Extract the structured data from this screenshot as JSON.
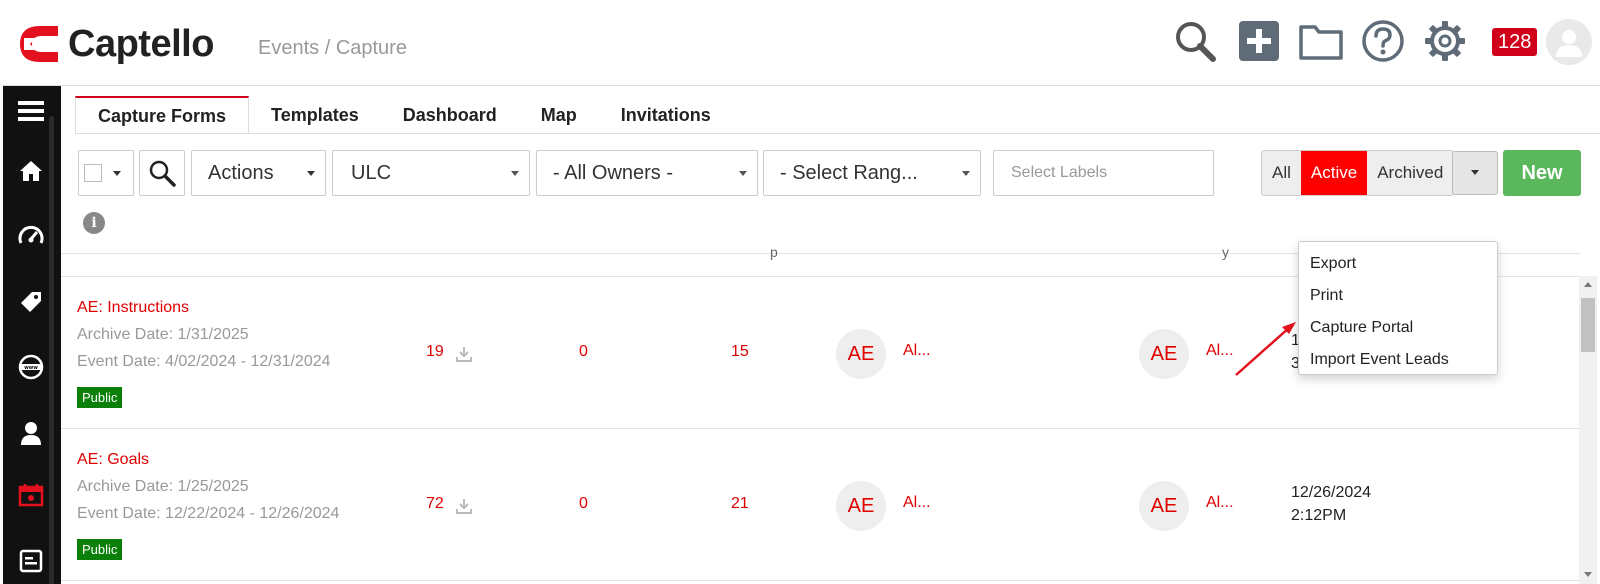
{
  "header": {
    "logo_text": "Captello",
    "breadcrumb": "Events / Capture",
    "notification_count": "128",
    "icons": [
      "search-icon",
      "add-icon",
      "folder-icon",
      "help-icon",
      "gear-icon",
      "user-avatar-icon"
    ]
  },
  "sidebar": {
    "items": [
      "menu-icon",
      "home-icon",
      "dashboard-icon",
      "tag-icon",
      "web-icon",
      "user-icon",
      "events-icon",
      "forms-icon"
    ]
  },
  "tabs": [
    {
      "label": "Capture Forms",
      "active": true
    },
    {
      "label": "Templates",
      "active": false
    },
    {
      "label": "Dashboard",
      "active": false
    },
    {
      "label": "Map",
      "active": false
    },
    {
      "label": "Invitations",
      "active": false
    }
  ],
  "toolbar": {
    "actions_label": "Actions",
    "event_select": "ULC",
    "owners_select": "- All Owners -",
    "range_select": "- Select Rang...",
    "labels_placeholder": "Select Labels",
    "filter_all": "All",
    "filter_active": "Active",
    "filter_archived": "Archived",
    "new_label": "New"
  },
  "column_fragments": [
    "p",
    "y"
  ],
  "rows": [
    {
      "title": "AE: Instructions",
      "archive_date": "Archive Date: 1/31/2025",
      "event_date": "Event Date: 4/02/2024 - 12/31/2024",
      "badge": "Public",
      "count1": "19",
      "count2": "0",
      "count3": "15",
      "owner_initials": "AE",
      "owner_name": "Al...",
      "modifier_initials": "AE",
      "modifier_name": "Al...",
      "date_line1": "1",
      "date_line2": "3"
    },
    {
      "title": "AE: Goals",
      "archive_date": "Archive Date: 1/25/2025",
      "event_date": "Event Date: 12/22/2024 - 12/26/2024",
      "badge": "Public",
      "count1": "72",
      "count2": "0",
      "count3": "21",
      "owner_initials": "AE",
      "owner_name": "Al...",
      "modifier_initials": "AE",
      "modifier_name": "Al...",
      "date_line1": "12/26/2024",
      "date_line2": "2:12PM"
    }
  ],
  "menu": {
    "items": [
      "Export",
      "Print",
      "Capture Portal",
      "Import Event Leads"
    ]
  },
  "colors": {
    "brand_red": "#d0021b",
    "active_red": "#ff0000",
    "new_green": "#5bb75b",
    "public_green": "#0a7f0a",
    "sidebar_bg": "#111111"
  }
}
